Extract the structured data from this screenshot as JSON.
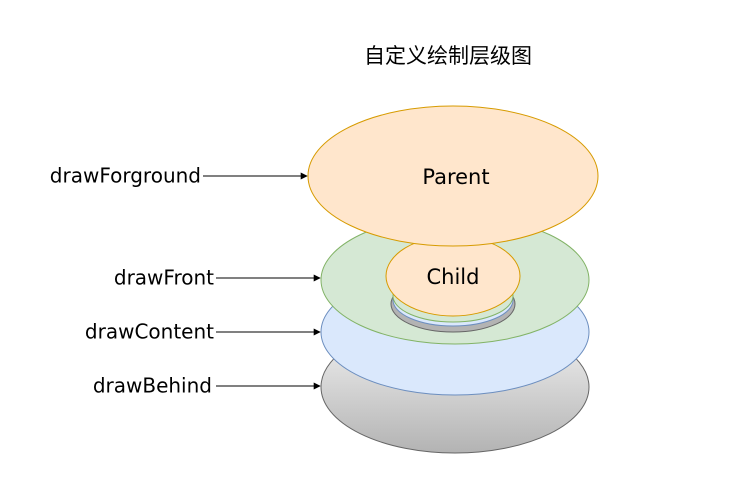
{
  "title": "自定义绘制层级图",
  "labels": {
    "foreground": "drawForground",
    "front": "drawFront",
    "content": "drawContent",
    "behind": "drawBehind"
  },
  "nodes": {
    "parent": "Parent",
    "child": "Child"
  },
  "colors": {
    "parent_fill": "#ffe6cc",
    "parent_stroke": "#d79b00",
    "front_fill": "#d5e8d4",
    "front_stroke": "#82b366",
    "content_fill": "#dae8fc",
    "content_stroke": "#6c8ebf",
    "behind_fill_top": "#f5f5f5",
    "behind_fill_bottom": "#b3b3b3",
    "behind_stroke": "#666666"
  }
}
